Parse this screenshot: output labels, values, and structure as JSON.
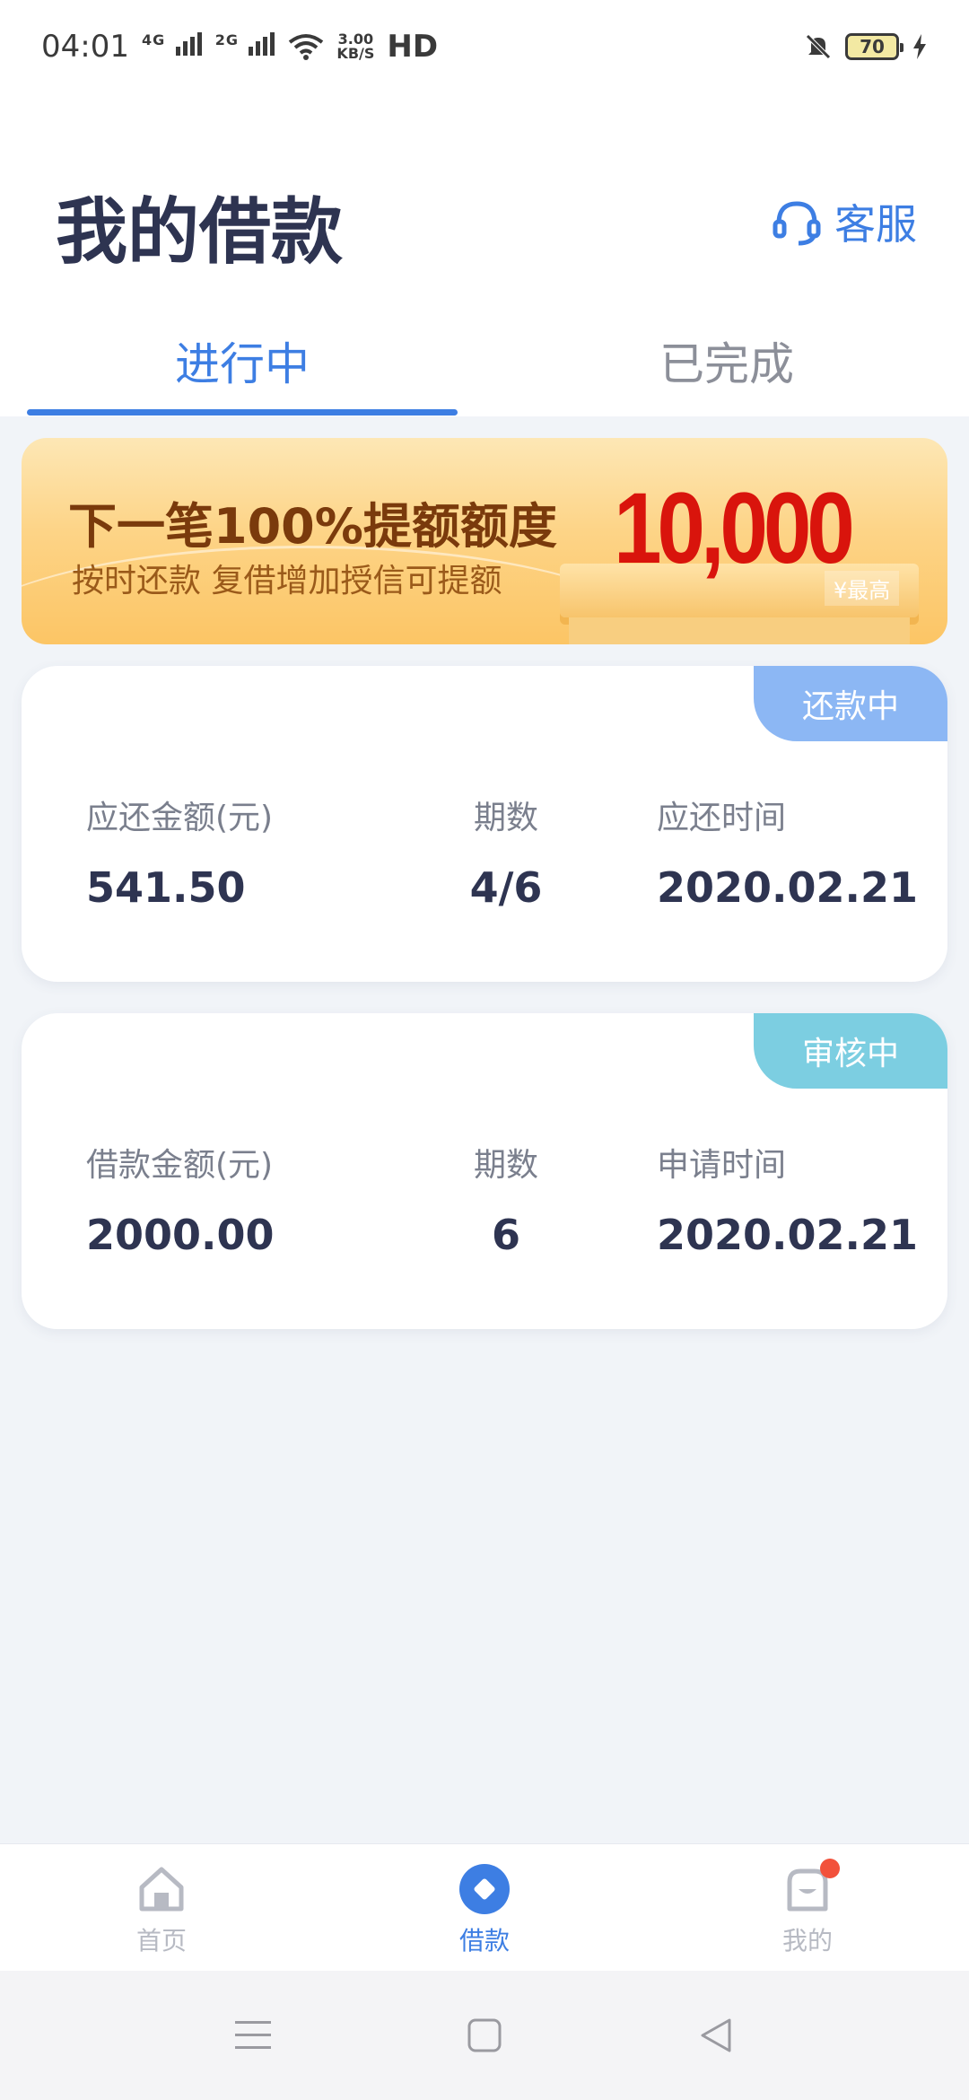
{
  "status_bar": {
    "time": "04:01",
    "network_1": "4G",
    "network_2": "2G",
    "speed_value": "3.00",
    "speed_unit": "KB/S",
    "hd": "HD",
    "battery": "70"
  },
  "header": {
    "title": "我的借款",
    "service_label": "客服"
  },
  "tabs": [
    {
      "label": "进行中",
      "active": true
    },
    {
      "label": "已完成",
      "active": false
    }
  ],
  "banner": {
    "title": "下一笔100%提额额度",
    "subtitle": "按时还款  复借增加授信可提额",
    "amount": "10,000",
    "max_label": "¥最高"
  },
  "loans": [
    {
      "status": "还款中",
      "status_color": "#8cb7f4",
      "fields": [
        {
          "label": "应还金额(元)",
          "value": "541.50"
        },
        {
          "label": "期数",
          "value": "4/6"
        },
        {
          "label": "应还时间",
          "value": "2020.02.21"
        }
      ]
    },
    {
      "status": "审核中",
      "status_color": "#7ccee1",
      "fields": [
        {
          "label": "借款金额(元)",
          "value": "2000.00"
        },
        {
          "label": "期数",
          "value": "6"
        },
        {
          "label": "申请时间",
          "value": "2020.02.21"
        }
      ]
    }
  ],
  "bottom_nav": [
    {
      "label": "首页",
      "icon": "home-icon",
      "active": false
    },
    {
      "label": "借款",
      "icon": "loan-icon",
      "active": true
    },
    {
      "label": "我的",
      "icon": "profile-icon",
      "active": false,
      "badge": true
    }
  ],
  "colors": {
    "accent": "#3d7ee3",
    "title": "#2e3451",
    "background": "#f1f4f8",
    "banner_amount": "#d9140c"
  }
}
